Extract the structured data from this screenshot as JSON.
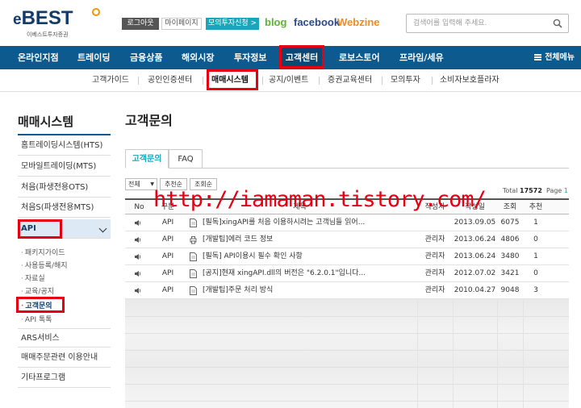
{
  "header": {
    "logo_text": "BEST",
    "logo_e": "e",
    "logo_sub": "이베스트투자증권",
    "logout": "로그아웃",
    "mypage": "마이페이지",
    "mock_apply": "모의투자신청 >",
    "blog": "blog",
    "facebook": "facebook",
    "webzine": "Webzine",
    "search_placeholder": "검색어를 입력해 주세요."
  },
  "gnb": {
    "items": [
      "온라인지점",
      "트레이딩",
      "금융상품",
      "해외시장",
      "투자정보",
      "고객센터",
      "로보스토어",
      "프라임/세유"
    ],
    "menu_all": "전체메뉴",
    "active": "고객센터"
  },
  "lnb": {
    "items": [
      "고객가이드",
      "공인인증센터",
      "매매시스템",
      "공지/이벤트",
      "증권교육센터",
      "모의투자",
      "소비자보호플라자"
    ],
    "active": "매매시스템"
  },
  "side": {
    "title": "매매시스템",
    "items": [
      "홈트레이딩시스템(HTS)",
      "모바일트레이딩(MTS)",
      "처음(파생전용OTS)",
      "처음S(파생전용MTS)",
      "API"
    ],
    "subitems": [
      "패키지가이드",
      "사용등록/해지",
      "자료실",
      "교육/공지",
      "고객문의",
      "API 톡톡"
    ],
    "bottom_items": [
      "ARS서비스",
      "매매주문관련 이용안내",
      "기타프로그램"
    ]
  },
  "content": {
    "title": "고객문의",
    "tabs": [
      "고객문의",
      "FAQ"
    ],
    "filter_select": "전체",
    "sort_buttons": [
      "추천순",
      "조회순"
    ],
    "total_label": "Total",
    "total_value": "17572",
    "page_label": "Page",
    "page_value": "1",
    "columns": [
      "No",
      "구분",
      "제목",
      "작성자",
      "작성일",
      "조회",
      "추천"
    ],
    "rows": [
      {
        "cat": "API",
        "title": "[필독]xingAPI를 처음 이용하시려는 고객님들 읽어...",
        "author": "",
        "date": "2013.09.05",
        "views": "6075",
        "recommend": "1"
      },
      {
        "cat": "API",
        "title": "[개발팁]에러 코드 정보",
        "author": "관리자",
        "date": "2013.06.24",
        "views": "4806",
        "recommend": "0"
      },
      {
        "cat": "API",
        "title": "[필독] API이용시 필수 확인 사항",
        "author": "관리자",
        "date": "2013.06.24",
        "views": "3480",
        "recommend": "1"
      },
      {
        "cat": "API",
        "title": "[공지]현재 xingAPI.dll의 버전은 \"6.2.0.1\"입니다...",
        "author": "관리자",
        "date": "2012.07.02",
        "views": "3421",
        "recommend": "0"
      },
      {
        "cat": "API",
        "title": "[개발팁]주문 처리 방식",
        "author": "관리자",
        "date": "2010.04.27",
        "views": "9048",
        "recommend": "3"
      }
    ]
  },
  "watermark": "http://iamaman.tistory.com/",
  "colors": {
    "brand_navy": "#0d5a8f",
    "accent_teal": "#1aa6b7",
    "highlight_red": "#e60012",
    "logo_orange": "#f39800"
  }
}
